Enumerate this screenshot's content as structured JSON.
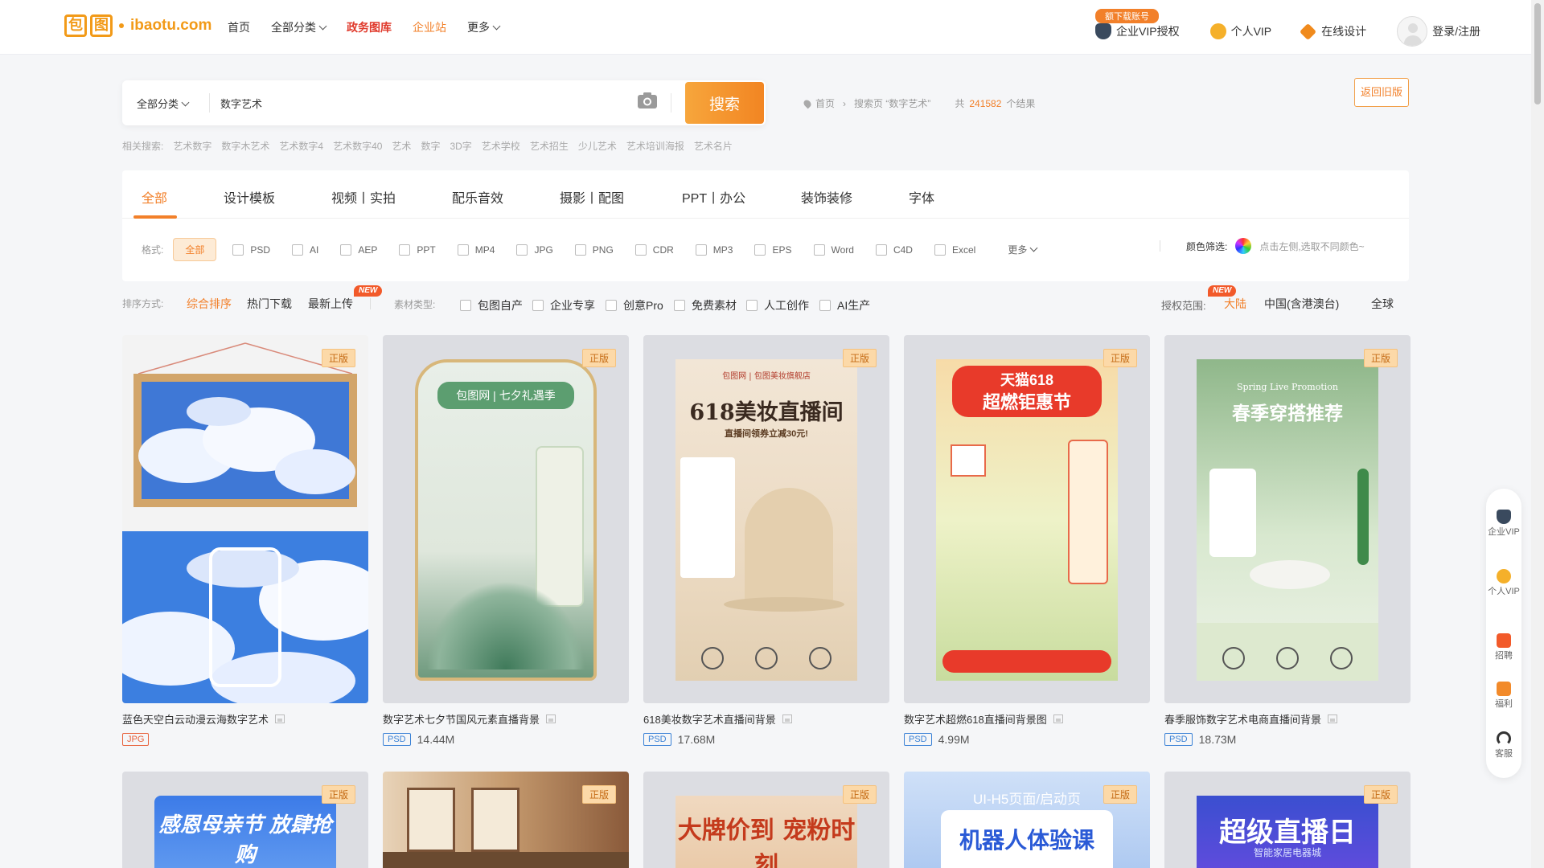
{
  "brand": {
    "logo_chars": [
      "包",
      "图"
    ],
    "domain": "ibaotu.com",
    "accent": "#f2802a"
  },
  "nav": {
    "home": "首页",
    "all_categories": "全部分类",
    "gov": "政务图库",
    "enterprise": "企业站",
    "more": "更多"
  },
  "topright": {
    "download_badge": "额下载账号",
    "enterprise_vip": "企业VIP授权",
    "personal_vip": "个人VIP",
    "online_design": "在线设计",
    "login": "登录/注册"
  },
  "search": {
    "category": "全部分类",
    "query": "数字艺术",
    "button": "搜索",
    "back_old": "返回旧版"
  },
  "breadcrumb": {
    "home": "首页",
    "page": "搜索页 “数字艺术”",
    "total_prefix": "共",
    "total": "241582",
    "total_suffix": "个结果"
  },
  "related": {
    "label": "相关搜索:",
    "items": [
      "艺术数字",
      "数字木艺术",
      "艺术数字4",
      "艺术数字40",
      "艺术",
      "数字",
      "3D字",
      "艺术学校",
      "艺术招生",
      "少儿艺术",
      "艺术培训海报",
      "艺术名片"
    ]
  },
  "tabs": [
    "全部",
    "设计模板",
    "视频丨实拍",
    "配乐音效",
    "摄影丨配图",
    "PPT丨办公",
    "装饰装修",
    "字体"
  ],
  "formats": {
    "label": "格式:",
    "all": "全部",
    "items": [
      "PSD",
      "AI",
      "AEP",
      "PPT",
      "MP4",
      "JPG",
      "PNG",
      "CDR",
      "MP3",
      "EPS",
      "Word",
      "C4D",
      "Excel"
    ],
    "more": "更多"
  },
  "color_filter": {
    "label": "颜色筛选:",
    "hint": "点击左侧,选取不同颜色~"
  },
  "sort": {
    "label": "排序方式:",
    "options": [
      "综合排序",
      "热门下载",
      "最新上传"
    ],
    "new_tag": "NEW"
  },
  "material_types": {
    "label": "素材类型:",
    "items": [
      "包图自产",
      "企业专享",
      "创意Pro",
      "免费素材",
      "人工创作",
      "AI生产"
    ]
  },
  "license": {
    "label": "授权范围:",
    "options": [
      "大陆",
      "中国(含港澳台)",
      "全球"
    ],
    "new_tag": "NEW"
  },
  "cards": [
    {
      "title": "蓝色天空白云动漫云海数字艺术",
      "format": "JPG",
      "size": "",
      "badge": "正版"
    },
    {
      "title": "数字艺术七夕节国风元素直播背景",
      "format": "PSD",
      "size": "14.44M",
      "badge": "正版",
      "poster_text": "包图网 | 七夕礼遇季"
    },
    {
      "title": "618美妆数字艺术直播间背景",
      "format": "PSD",
      "size": "17.68M",
      "badge": "正版",
      "poster_text": "618美妆直播间",
      "poster_sub": "直播间领券立减30元!",
      "poster_head": "包图网 | 包图美妆旗舰店"
    },
    {
      "title": "数字艺术超燃618直播间背景图",
      "format": "PSD",
      "size": "4.99M",
      "badge": "正版",
      "poster_text": "天猫618",
      "poster_sub": "超燃钜惠节"
    },
    {
      "title": "春季服饰数字艺术电商直播间背景",
      "format": "PSD",
      "size": "18.73M",
      "badge": "正版",
      "poster_text": "春季穿搭推荐",
      "poster_head": "Spring Live Promotion"
    }
  ],
  "row2": [
    {
      "badge": "正版",
      "poster_text": "感恩母亲节 放肆抢购"
    },
    {
      "badge": "正版",
      "poster_text": ""
    },
    {
      "badge": "正版",
      "poster_text": "大牌价到 宠粉时刻"
    },
    {
      "badge": "正版",
      "poster_text": "机器人体验课",
      "poster_head": "UI-H5页面/启动页"
    },
    {
      "badge": "正版",
      "poster_text": "超级直播日",
      "poster_sub": "智能家居电器城"
    }
  ],
  "sidefloat": [
    "企业VIP",
    "个人VIP",
    "招聘",
    "福利",
    "客服"
  ]
}
